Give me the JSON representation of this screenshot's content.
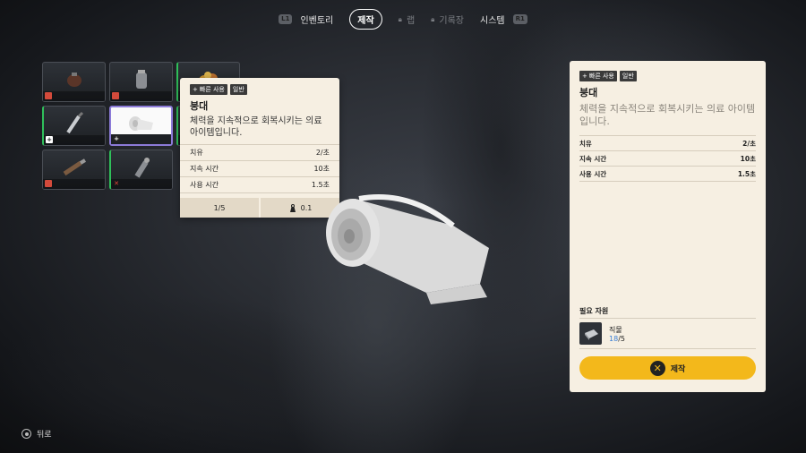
{
  "nav": {
    "l1": "L1",
    "r1": "R1",
    "tabs": [
      {
        "label": "인벤토리",
        "locked": false
      },
      {
        "label": "제작",
        "active": true
      },
      {
        "label": "랩",
        "locked": true
      },
      {
        "label": "기록장",
        "locked": true
      },
      {
        "label": "시스템",
        "locked": false
      }
    ]
  },
  "tooltip": {
    "tag_quick": "빠른 사용",
    "tag_type": "일반",
    "title": "붕대",
    "description": "체력을 지속적으로 회복시키는 의료 아이템입니다.",
    "stats": [
      {
        "label": "치유",
        "value": "2/초"
      },
      {
        "label": "지속 시간",
        "value": "10초"
      },
      {
        "label": "사용 시간",
        "value": "1.5초"
      }
    ],
    "stack": "1/5",
    "weight": "0.1"
  },
  "panel": {
    "tag_quick": "빠른 사용",
    "tag_type": "일반",
    "title": "붕대",
    "description": "체력을 지속적으로 회복시키는 의료 아이템입니다.",
    "stats": [
      {
        "label": "치유",
        "value": "2/초"
      },
      {
        "label": "지속 시간",
        "value": "10초"
      },
      {
        "label": "사용 시간",
        "value": "1.5초"
      }
    ],
    "required_title": "필요 자원",
    "required": {
      "name": "직물",
      "have": "18",
      "need": "/5"
    },
    "craft_label": "제작"
  },
  "back_label": "뒤로",
  "colors": {
    "accent": "#f3b81b",
    "panel": "#f6efe2",
    "selected_border": "#8c7bd8",
    "green": "#2fbf5a",
    "red": "#d34a3b"
  },
  "grid_items": [
    {
      "icon": "grenade-icon",
      "badge": "red"
    },
    {
      "icon": "canister-icon",
      "badge": "red"
    },
    {
      "icon": "food-pile-icon",
      "badge": "none"
    },
    {
      "icon": "syringe-icon",
      "badge": "white"
    },
    {
      "icon": "bandage-icon",
      "badge": "white",
      "selected": true
    },
    {
      "icon": "stun-gun-icon",
      "badge": "none"
    },
    {
      "icon": "shotgun-shell-icon",
      "badge": "red"
    },
    {
      "icon": "spray-can-icon",
      "badge": "x"
    }
  ]
}
